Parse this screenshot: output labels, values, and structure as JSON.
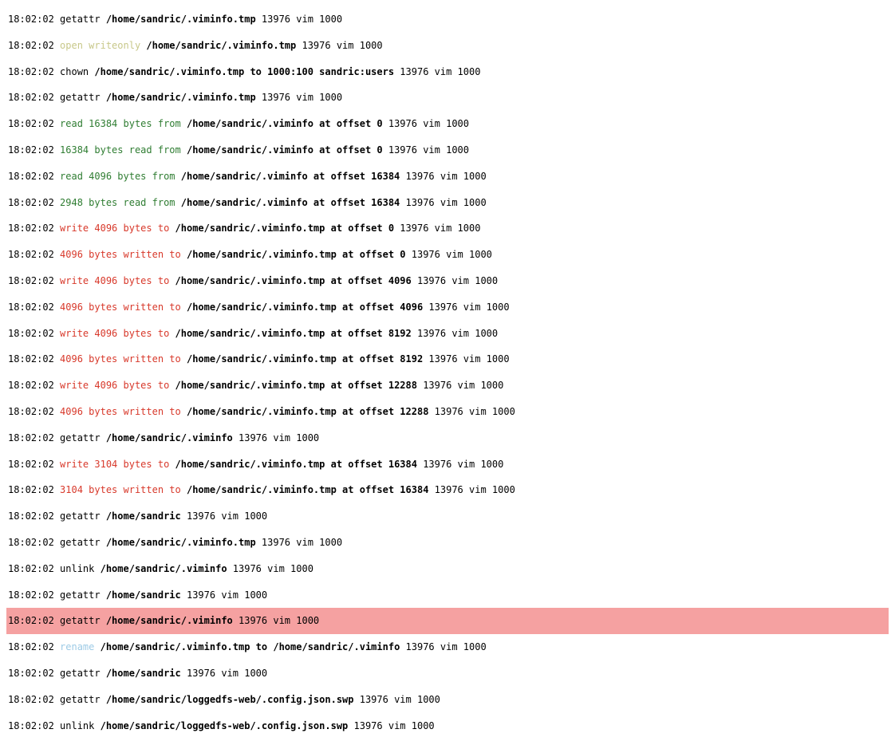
{
  "rows": [
    {
      "spans": [
        {
          "t": "18:02:02 "
        },
        {
          "t": "getattr "
        },
        {
          "t": "/home/sandric/.viminfo.tmp",
          "c": "bold"
        },
        {
          "t": " 13976 vim 1000"
        }
      ]
    },
    {
      "spans": [
        {
          "t": "18:02:02 "
        },
        {
          "t": "open writeonly ",
          "c": "olive"
        },
        {
          "t": "/home/sandric/.viminfo.tmp",
          "c": "bold"
        },
        {
          "t": " 13976 vim 1000"
        }
      ]
    },
    {
      "spans": [
        {
          "t": "18:02:02 "
        },
        {
          "t": "chown "
        },
        {
          "t": "/home/sandric/.viminfo.tmp to 1000:100 sandric:users",
          "c": "bold"
        },
        {
          "t": " 13976 vim 1000"
        }
      ]
    },
    {
      "spans": [
        {
          "t": "18:02:02 "
        },
        {
          "t": "getattr "
        },
        {
          "t": "/home/sandric/.viminfo.tmp",
          "c": "bold"
        },
        {
          "t": " 13976 vim 1000"
        }
      ]
    },
    {
      "spans": [
        {
          "t": "18:02:02 "
        },
        {
          "t": "read 16384 bytes from ",
          "c": "green"
        },
        {
          "t": "/home/sandric/.viminfo at offset 0",
          "c": "bold"
        },
        {
          "t": " 13976 vim 1000"
        }
      ]
    },
    {
      "spans": [
        {
          "t": "18:02:02 "
        },
        {
          "t": "16384 bytes read from ",
          "c": "green"
        },
        {
          "t": "/home/sandric/.viminfo at offset 0",
          "c": "bold"
        },
        {
          "t": " 13976 vim 1000"
        }
      ]
    },
    {
      "spans": [
        {
          "t": "18:02:02 "
        },
        {
          "t": "read 4096 bytes from ",
          "c": "green"
        },
        {
          "t": "/home/sandric/.viminfo at offset 16384",
          "c": "bold"
        },
        {
          "t": " 13976 vim 1000"
        }
      ]
    },
    {
      "spans": [
        {
          "t": "18:02:02 "
        },
        {
          "t": "2948 bytes read from ",
          "c": "green"
        },
        {
          "t": "/home/sandric/.viminfo at offset 16384",
          "c": "bold"
        },
        {
          "t": " 13976 vim 1000"
        }
      ]
    },
    {
      "spans": [
        {
          "t": "18:02:02 "
        },
        {
          "t": "write 4096 bytes to ",
          "c": "red"
        },
        {
          "t": "/home/sandric/.viminfo.tmp at offset 0",
          "c": "bold"
        },
        {
          "t": " 13976 vim 1000"
        }
      ]
    },
    {
      "spans": [
        {
          "t": "18:02:02 "
        },
        {
          "t": "4096 bytes written to ",
          "c": "red"
        },
        {
          "t": "/home/sandric/.viminfo.tmp at offset 0",
          "c": "bold"
        },
        {
          "t": " 13976 vim 1000"
        }
      ]
    },
    {
      "spans": [
        {
          "t": "18:02:02 "
        },
        {
          "t": "write 4096 bytes to ",
          "c": "red"
        },
        {
          "t": "/home/sandric/.viminfo.tmp at offset 4096",
          "c": "bold"
        },
        {
          "t": " 13976 vim 1000"
        }
      ]
    },
    {
      "spans": [
        {
          "t": "18:02:02 "
        },
        {
          "t": "4096 bytes written to ",
          "c": "red"
        },
        {
          "t": "/home/sandric/.viminfo.tmp at offset 4096",
          "c": "bold"
        },
        {
          "t": " 13976 vim 1000"
        }
      ]
    },
    {
      "spans": [
        {
          "t": "18:02:02 "
        },
        {
          "t": "write 4096 bytes to ",
          "c": "red"
        },
        {
          "t": "/home/sandric/.viminfo.tmp at offset 8192",
          "c": "bold"
        },
        {
          "t": " 13976 vim 1000"
        }
      ]
    },
    {
      "spans": [
        {
          "t": "18:02:02 "
        },
        {
          "t": "4096 bytes written to ",
          "c": "red"
        },
        {
          "t": "/home/sandric/.viminfo.tmp at offset 8192",
          "c": "bold"
        },
        {
          "t": " 13976 vim 1000"
        }
      ]
    },
    {
      "spans": [
        {
          "t": "18:02:02 "
        },
        {
          "t": "write 4096 bytes to ",
          "c": "red"
        },
        {
          "t": "/home/sandric/.viminfo.tmp at offset 12288",
          "c": "bold"
        },
        {
          "t": " 13976 vim 1000"
        }
      ]
    },
    {
      "spans": [
        {
          "t": "18:02:02 "
        },
        {
          "t": "4096 bytes written to ",
          "c": "red"
        },
        {
          "t": "/home/sandric/.viminfo.tmp at offset 12288",
          "c": "bold"
        },
        {
          "t": " 13976 vim 1000"
        }
      ]
    },
    {
      "spans": [
        {
          "t": "18:02:02 "
        },
        {
          "t": "getattr "
        },
        {
          "t": "/home/sandric/.viminfo",
          "c": "bold"
        },
        {
          "t": " 13976 vim 1000"
        }
      ]
    },
    {
      "spans": [
        {
          "t": "18:02:02 "
        },
        {
          "t": "write 3104 bytes to ",
          "c": "red"
        },
        {
          "t": "/home/sandric/.viminfo.tmp at offset 16384",
          "c": "bold"
        },
        {
          "t": " 13976 vim 1000"
        }
      ]
    },
    {
      "spans": [
        {
          "t": "18:02:02 "
        },
        {
          "t": "3104 bytes written to ",
          "c": "red"
        },
        {
          "t": "/home/sandric/.viminfo.tmp at offset 16384",
          "c": "bold"
        },
        {
          "t": " 13976 vim 1000"
        }
      ]
    },
    {
      "spans": [
        {
          "t": "18:02:02 "
        },
        {
          "t": "getattr "
        },
        {
          "t": "/home/sandric",
          "c": "bold"
        },
        {
          "t": " 13976 vim 1000"
        }
      ]
    },
    {
      "spans": [
        {
          "t": "18:02:02 "
        },
        {
          "t": "getattr "
        },
        {
          "t": "/home/sandric/.viminfo.tmp",
          "c": "bold"
        },
        {
          "t": " 13976 vim 1000"
        }
      ]
    },
    {
      "spans": [
        {
          "t": "18:02:02 "
        },
        {
          "t": "unlink "
        },
        {
          "t": "/home/sandric/.viminfo",
          "c": "bold"
        },
        {
          "t": " 13976 vim 1000"
        }
      ]
    },
    {
      "spans": [
        {
          "t": "18:02:02 "
        },
        {
          "t": "getattr "
        },
        {
          "t": "/home/sandric",
          "c": "bold"
        },
        {
          "t": " 13976 vim 1000"
        }
      ]
    },
    {
      "hl": true,
      "spans": [
        {
          "t": "18:02:02 "
        },
        {
          "t": "getattr "
        },
        {
          "t": "/home/sandric/.viminfo",
          "c": "bold"
        },
        {
          "t": " 13976 vim 1000"
        }
      ]
    },
    {
      "spans": [
        {
          "t": "18:02:02 "
        },
        {
          "t": "rename ",
          "c": "lightblue"
        },
        {
          "t": "/home/sandric/.viminfo.tmp to /home/sandric/.viminfo",
          "c": "bold"
        },
        {
          "t": " 13976 vim 1000"
        }
      ]
    },
    {
      "spans": [
        {
          "t": "18:02:02 "
        },
        {
          "t": "getattr "
        },
        {
          "t": "/home/sandric",
          "c": "bold"
        },
        {
          "t": " 13976 vim 1000"
        }
      ]
    },
    {
      "spans": [
        {
          "t": "18:02:02 "
        },
        {
          "t": "getattr "
        },
        {
          "t": "/home/sandric/loggedfs-web/.config.json.swp",
          "c": "bold"
        },
        {
          "t": " 13976 vim 1000"
        }
      ]
    },
    {
      "spans": [
        {
          "t": "18:02:02 "
        },
        {
          "t": "unlink "
        },
        {
          "t": "/home/sandric/loggedfs-web/.config.json.swp",
          "c": "bold"
        },
        {
          "t": " 13976 vim 1000"
        }
      ]
    }
  ]
}
